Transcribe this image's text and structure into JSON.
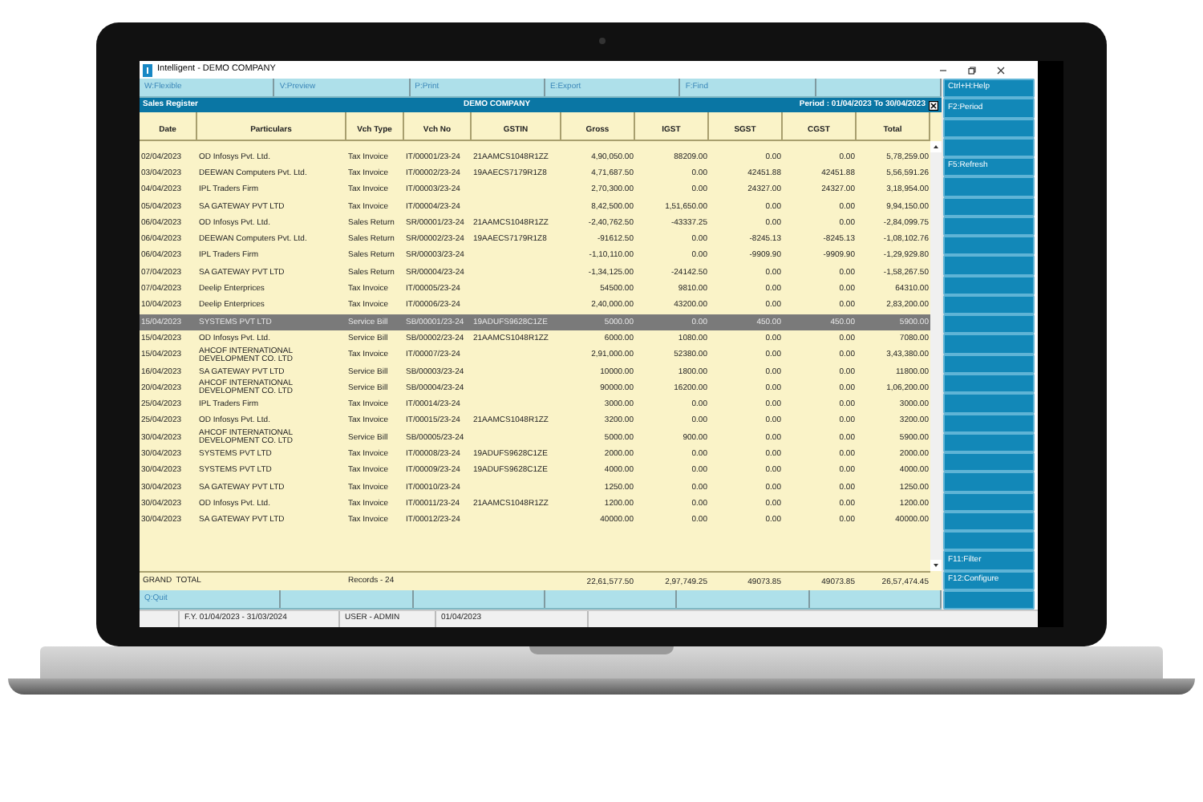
{
  "window": {
    "title": "Intelligent - DEMO COMPANY"
  },
  "toolbar": [
    {
      "label": "W:Flexible"
    },
    {
      "label": "V:Preview"
    },
    {
      "label": "P:Print"
    },
    {
      "label": "E:Export"
    },
    {
      "label": "F:Find"
    },
    {
      "kind": "blank"
    }
  ],
  "report_header": {
    "title": "Sales Register",
    "company": "DEMO COMPANY",
    "period": "Period : 01/04/2023 To 30/04/2023"
  },
  "table": {
    "columns": [
      "Date",
      "Particulars",
      "Vch Type",
      "Vch No",
      "GSTIN",
      "Gross",
      "IGST",
      "SGST",
      "CGST",
      "Total"
    ],
    "rows": [
      {
        "selected": false,
        "date": "02/04/2023",
        "particulars": "OD Infosys Pvt. Ltd.",
        "vch_type": "Tax Invoice",
        "vch_no": "IT/00001/23-24",
        "gstin": "21AAMCS1048R1ZZ",
        "gross": "4,90,050.00",
        "igst": "88209.00",
        "sgst": "0.00",
        "cgst": "0.00",
        "total": "5,78,259.00"
      },
      {
        "selected": false,
        "date": "03/04/2023",
        "particulars": "DEEWAN Computers Pvt. Ltd.",
        "vch_type": "Tax Invoice",
        "vch_no": "IT/00002/23-24",
        "gstin": "19AAECS7179R1Z8",
        "gross": "4,71,687.50",
        "igst": "0.00",
        "sgst": "42451.88",
        "cgst": "42451.88",
        "total": "5,56,591.26"
      },
      {
        "selected": false,
        "date": "04/04/2023",
        "particulars": "IPL Traders Firm",
        "vch_type": "Tax Invoice",
        "vch_no": "IT/00003/23-24",
        "gross": "2,70,300.00",
        "igst": "0.00",
        "sgst": "24327.00",
        "cgst": "24327.00",
        "total": "3,18,954.00"
      },
      {
        "selected": false,
        "date": "05/04/2023",
        "particulars": "SA GATEWAY PVT LTD",
        "vch_type": "Tax Invoice",
        "vch_no": "IT/00004/23-24",
        "gross": "8,42,500.00",
        "igst": "1,51,650.00",
        "sgst": "0.00",
        "cgst": "0.00",
        "total": "9,94,150.00"
      },
      {
        "selected": false,
        "date": "06/04/2023",
        "particulars": "OD Infosys Pvt. Ltd.",
        "vch_type": "Sales Return",
        "vch_no": "SR/00001/23-24",
        "gstin": "21AAMCS1048R1ZZ",
        "gross": "-2,40,762.50",
        "igst": "-43337.25",
        "sgst": "0.00",
        "cgst": "0.00",
        "total": "-2,84,099.75"
      },
      {
        "selected": false,
        "date": "06/04/2023",
        "particulars": "DEEWAN Computers Pvt. Ltd.",
        "vch_type": "Sales Return",
        "vch_no": "SR/00002/23-24",
        "gstin": "19AAECS7179R1Z8",
        "gross": "-91612.50",
        "igst": "0.00",
        "sgst": "-8245.13",
        "cgst": "-8245.13",
        "total": "-1,08,102.76"
      },
      {
        "selected": false,
        "date": "06/04/2023",
        "particulars": "IPL Traders Firm",
        "vch_type": "Sales Return",
        "vch_no": "SR/00003/23-24",
        "gross": "-1,10,110.00",
        "igst": "0.00",
        "sgst": "-9909.90",
        "cgst": "-9909.90",
        "total": "-1,29,929.80"
      },
      {
        "selected": false,
        "date": "07/04/2023",
        "particulars": "SA GATEWAY PVT LTD",
        "vch_type": "Sales Return",
        "vch_no": "SR/00004/23-24",
        "gross": "-1,34,125.00",
        "igst": "-24142.50",
        "sgst": "0.00",
        "cgst": "0.00",
        "total": "-1,58,267.50"
      },
      {
        "selected": false,
        "date": "07/04/2023",
        "particulars": "Deelip Enterprices",
        "vch_type": "Tax Invoice",
        "vch_no": "IT/00005/23-24",
        "gross": "54500.00",
        "igst": "9810.00",
        "sgst": "0.00",
        "cgst": "0.00",
        "total": "64310.00"
      },
      {
        "selected": false,
        "date": "10/04/2023",
        "particulars": "Deelip Enterprices",
        "vch_type": "Tax Invoice",
        "vch_no": "IT/00006/23-24",
        "gross": "2,40,000.00",
        "igst": "43200.00",
        "sgst": "0.00",
        "cgst": "0.00",
        "total": "2,83,200.00"
      },
      {
        "selected": true,
        "date": "15/04/2023",
        "particulars": "SYSTEMS PVT LTD",
        "vch_type": "Service Bill",
        "vch_no": "SB/00001/23-24",
        "gstin": "19ADUFS9628C1ZE",
        "gross": "5000.00",
        "igst": "0.00",
        "sgst": "450.00",
        "cgst": "450.00",
        "total": "5900.00"
      },
      {
        "selected": false,
        "date": "15/04/2023",
        "particulars": "OD Infosys Pvt. Ltd.",
        "vch_type": "Service Bill",
        "vch_no": "SB/00002/23-24",
        "gstin": "21AAMCS1048R1ZZ",
        "gross": "6000.00",
        "igst": "1080.00",
        "sgst": "0.00",
        "cgst": "0.00",
        "total": "7080.00"
      },
      {
        "selected": false,
        "date": "15/04/2023",
        "particulars": "AHCOF INTERNATIONAL DEVELOPMENT CO. LTD",
        "vch_type": "Tax Invoice",
        "vch_no": "IT/00007/23-24",
        "gross": "2,91,000.00",
        "igst": "52380.00",
        "sgst": "0.00",
        "cgst": "0.00",
        "total": "3,43,380.00"
      },
      {
        "selected": false,
        "date": "16/04/2023",
        "particulars": "SA GATEWAY PVT LTD",
        "vch_type": "Service Bill",
        "vch_no": "SB/00003/23-24",
        "gross": "10000.00",
        "igst": "1800.00",
        "sgst": "0.00",
        "cgst": "0.00",
        "total": "11800.00"
      },
      {
        "selected": false,
        "date": "20/04/2023",
        "particulars": "AHCOF INTERNATIONAL DEVELOPMENT CO. LTD",
        "vch_type": "Service Bill",
        "vch_no": "SB/00004/23-24",
        "gross": "90000.00",
        "igst": "16200.00",
        "sgst": "0.00",
        "cgst": "0.00",
        "total": "1,06,200.00"
      },
      {
        "selected": false,
        "date": "25/04/2023",
        "particulars": "IPL Traders Firm",
        "vch_type": "Tax Invoice",
        "vch_no": "IT/00014/23-24",
        "gross": "3000.00",
        "igst": "0.00",
        "sgst": "0.00",
        "cgst": "0.00",
        "total": "3000.00"
      },
      {
        "selected": false,
        "date": "25/04/2023",
        "particulars": "OD Infosys Pvt. Ltd.",
        "vch_type": "Tax Invoice",
        "vch_no": "IT/00015/23-24",
        "gstin": "21AAMCS1048R1ZZ",
        "gross": "3200.00",
        "igst": "0.00",
        "sgst": "0.00",
        "cgst": "0.00",
        "total": "3200.00"
      },
      {
        "selected": false,
        "date": "30/04/2023",
        "particulars": "AHCOF INTERNATIONAL DEVELOPMENT CO. LTD",
        "vch_type": "Service Bill",
        "vch_no": "SB/00005/23-24",
        "gross": "5000.00",
        "igst": "900.00",
        "sgst": "0.00",
        "cgst": "0.00",
        "total": "5900.00"
      },
      {
        "selected": false,
        "date": "30/04/2023",
        "particulars": "SYSTEMS PVT LTD",
        "vch_type": "Tax Invoice",
        "vch_no": "IT/00008/23-24",
        "gstin": "19ADUFS9628C1ZE",
        "gross": "2000.00",
        "igst": "0.00",
        "sgst": "0.00",
        "cgst": "0.00",
        "total": "2000.00"
      },
      {
        "selected": false,
        "date": "30/04/2023",
        "particulars": "SYSTEMS PVT LTD",
        "vch_type": "Tax Invoice",
        "vch_no": "IT/00009/23-24",
        "gstin": "19ADUFS9628C1ZE",
        "gross": "4000.00",
        "igst": "0.00",
        "sgst": "0.00",
        "cgst": "0.00",
        "total": "4000.00"
      },
      {
        "selected": false,
        "date": "30/04/2023",
        "particulars": "SA GATEWAY PVT LTD",
        "vch_type": "Tax Invoice",
        "vch_no": "IT/00010/23-24",
        "gross": "1250.00",
        "igst": "0.00",
        "sgst": "0.00",
        "cgst": "0.00",
        "total": "1250.00"
      },
      {
        "selected": false,
        "date": "30/04/2023",
        "particulars": "OD Infosys Pvt. Ltd.",
        "vch_type": "Tax Invoice",
        "vch_no": "IT/00011/23-24",
        "gstin": "21AAMCS1048R1ZZ",
        "gross": "1200.00",
        "igst": "0.00",
        "sgst": "0.00",
        "cgst": "0.00",
        "total": "1200.00"
      },
      {
        "selected": false,
        "date": "30/04/2023",
        "particulars": "SA GATEWAY PVT LTD",
        "vch_type": "Tax Invoice",
        "vch_no": "IT/00012/23-24",
        "gross": "40000.00",
        "igst": "0.00",
        "sgst": "0.00",
        "cgst": "0.00",
        "total": "40000.00"
      }
    ],
    "grand_total": {
      "label": "GRAND  TOTAL",
      "records": "Records - 24",
      "gross": "22,61,577.50",
      "igst": "2,97,749.25",
      "sgst": "49073.85",
      "cgst": "49073.85",
      "total": "26,57,474.45"
    }
  },
  "bottom_toolbar": [
    {
      "label": "Q:Quit"
    },
    {
      "kind": "blank"
    },
    {
      "kind": "blank"
    },
    {
      "kind": "blank"
    },
    {
      "kind": "blank"
    },
    {
      "kind": "blank"
    }
  ],
  "side_panel": [
    {
      "label": "Ctrl+H:Help"
    },
    {
      "label": "F2:Period"
    },
    {
      "kind": "blank"
    },
    {
      "kind": "blank"
    },
    {
      "label": "F5:Refresh"
    },
    {
      "kind": "blank"
    },
    {
      "kind": "blank"
    },
    {
      "kind": "blank"
    },
    {
      "kind": "blank"
    },
    {
      "kind": "blank"
    },
    {
      "kind": "blank"
    },
    {
      "kind": "blank"
    },
    {
      "kind": "blank"
    },
    {
      "kind": "blank"
    },
    {
      "kind": "blank"
    },
    {
      "kind": "blank"
    },
    {
      "kind": "blank"
    },
    {
      "kind": "blank"
    },
    {
      "kind": "blank"
    },
    {
      "kind": "blank"
    },
    {
      "kind": "blank"
    },
    {
      "kind": "blank"
    },
    {
      "kind": "blank"
    },
    {
      "kind": "blank"
    },
    {
      "label": "F11:Filter"
    },
    {
      "label": "F12:Configure"
    },
    {
      "kind": "blank"
    }
  ],
  "status_bar": [
    "F.Y. 01/04/2023 - 31/03/2024",
    "USER - ADMIN",
    "01/04/2023"
  ]
}
